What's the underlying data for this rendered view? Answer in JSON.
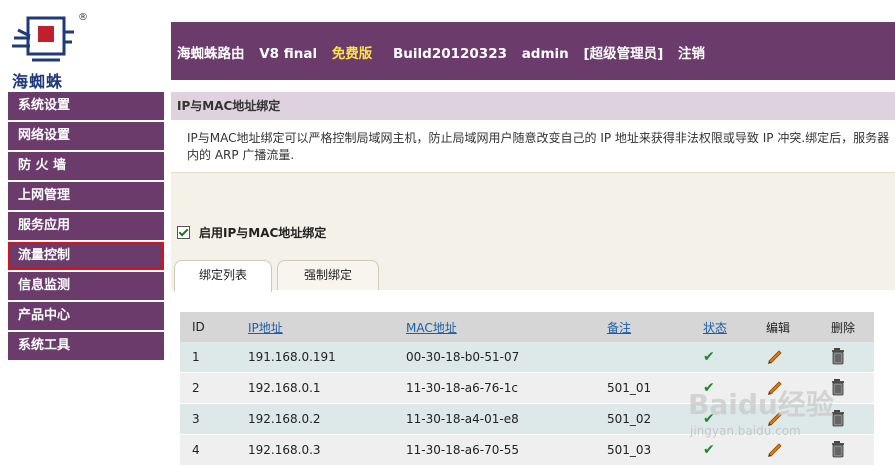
{
  "brand": {
    "name": "海蜘蛛",
    "reg": "®"
  },
  "header": {
    "product": "海蜘蛛路由",
    "version": "V8 final",
    "edition": "免费版",
    "build": "Build20120323",
    "user": "admin",
    "role": "[超级管理员]",
    "logout": "注销"
  },
  "sidebar": {
    "items": [
      {
        "label": "系统设置"
      },
      {
        "label": "网络设置"
      },
      {
        "label": "防 火 墙"
      },
      {
        "label": "上网管理"
      },
      {
        "label": "服务应用"
      },
      {
        "label": "流量控制"
      },
      {
        "label": "信息监测"
      },
      {
        "label": "产品中心"
      },
      {
        "label": "系统工具"
      }
    ]
  },
  "page": {
    "title": "IP与MAC地址绑定",
    "desc_line1": "IP与MAC地址绑定可以严格控制局域网主机，防止局域网用户随意改变自己的 IP 地址来获得非法权限或导致 IP 冲突.绑定后，服务器",
    "desc_line2": "内的 ARP 广播流量.",
    "enable_label": "启用IP与MAC地址绑定",
    "enable_checked": true
  },
  "tabs": [
    {
      "label": "绑定列表"
    },
    {
      "label": "强制绑定"
    }
  ],
  "table": {
    "headers": {
      "id": "ID",
      "ip": "IP地址",
      "mac": "MAC地址",
      "note": "备注",
      "status": "状态",
      "edit": "编辑",
      "delete": "删除"
    },
    "rows": [
      {
        "id": "1",
        "ip": "191.168.0.191",
        "mac": "00-30-18-b0-51-07",
        "note": ""
      },
      {
        "id": "2",
        "ip": "192.168.0.1",
        "mac": "11-30-18-a6-76-1c",
        "note": "501_01"
      },
      {
        "id": "3",
        "ip": "192.168.0.2",
        "mac": "11-30-18-a4-01-e8",
        "note": "501_02"
      },
      {
        "id": "4",
        "ip": "192.168.0.3",
        "mac": "11-30-18-a6-70-55",
        "note": "501_03"
      }
    ]
  },
  "watermark": {
    "text": "Baidu经验",
    "url": "jingyan.baidu.com"
  },
  "colors": {
    "accent": "#6b3b6b",
    "free": "#ffe24a",
    "link": "#1a5fa8",
    "check": "#1a8a2a",
    "highlight": "#e01010"
  }
}
